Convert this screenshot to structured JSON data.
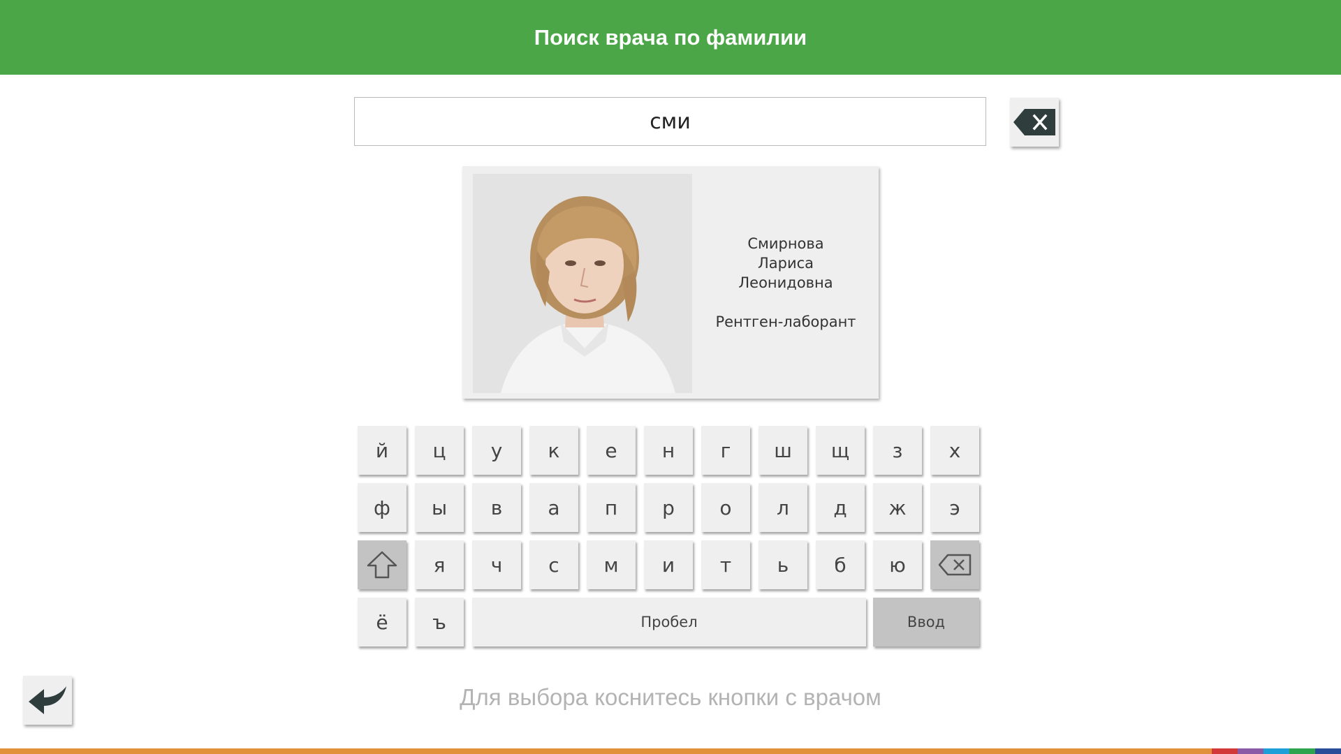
{
  "header": {
    "title": "Поиск врача по фамилии"
  },
  "search": {
    "value": "сми",
    "clear_icon": "backspace-icon"
  },
  "doctor": {
    "last_name": "Смирнова",
    "first_name": "Лариса",
    "patronymic": "Леонидовна",
    "role": "Рентген-лаборант"
  },
  "keyboard": {
    "row1": [
      "й",
      "ц",
      "у",
      "к",
      "е",
      "н",
      "г",
      "ш",
      "щ",
      "з",
      "х"
    ],
    "row2": [
      "ф",
      "ы",
      "в",
      "а",
      "п",
      "р",
      "о",
      "л",
      "д",
      "ж",
      "э"
    ],
    "row3": [
      "я",
      "ч",
      "с",
      "м",
      "и",
      "т",
      "ь",
      "б",
      "ю"
    ],
    "row4": [
      "ё",
      "ъ"
    ],
    "space_label": "Пробел",
    "enter_label": "Ввод",
    "shift_icon": "shift-icon",
    "backspace_icon": "backspace-icon"
  },
  "hint": "Для выбора коснитесь кнопки с врачом",
  "back_icon": "back-arrow-icon",
  "colors": {
    "header": "#4aa646",
    "key": "#efefef",
    "key_dark": "#c3c3c3",
    "bottom_bar": [
      "#e0913a",
      "#d23a3a",
      "#8a5aa6",
      "#1e9fd8",
      "#2ea44f",
      "#2a4d9a"
    ]
  }
}
